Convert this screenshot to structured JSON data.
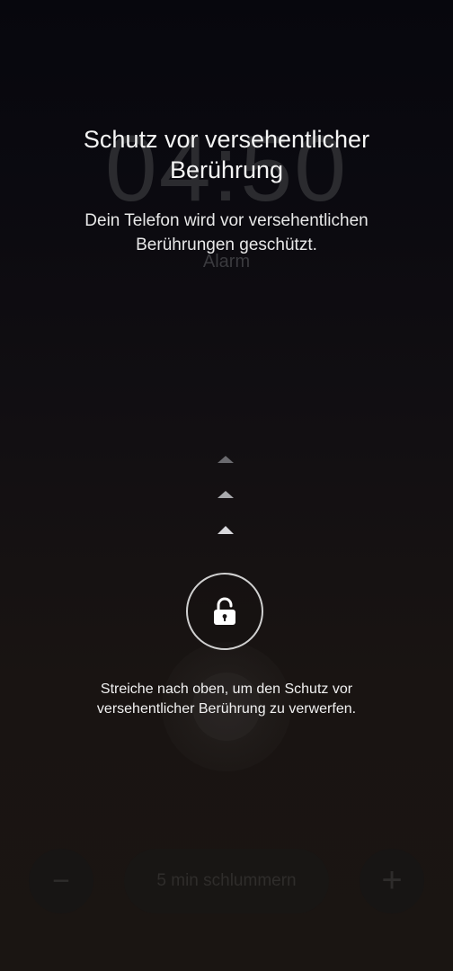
{
  "background_alarm": {
    "time": "04:50",
    "label": "Alarm",
    "snooze_label": "5 min schlummern",
    "minus_symbol": "−",
    "plus_symbol": "+"
  },
  "overlay": {
    "title": "Schutz vor versehentlicher Berührung",
    "description": "Dein Telefon wird vor versehentlichen Berührungen geschützt.",
    "hint": "Streiche nach oben, um den Schutz vor versehentlicher Berührung zu verwerfen.",
    "unlock_icon": "unlock-icon",
    "swipe_indicator_icon": "chevron-up-icon"
  },
  "colors": {
    "text": "#ffffff",
    "ring": "#d0d0d0",
    "background_top": "#07070d",
    "background_bottom": "#1a1512"
  }
}
